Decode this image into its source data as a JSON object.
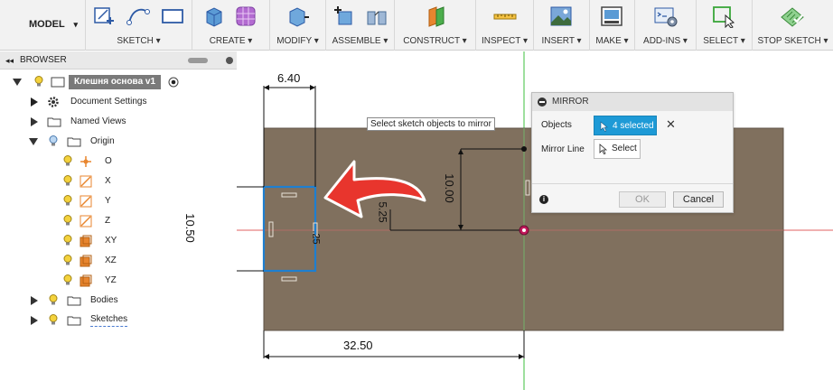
{
  "toolbar": {
    "mode_label": "MODEL",
    "groups": {
      "sketch": "SKETCH ▾",
      "create": "CREATE ▾",
      "modify": "MODIFY ▾",
      "assemble": "ASSEMBLE ▾",
      "construct": "CONSTRUCT ▾",
      "inspect": "INSPECT ▾",
      "insert": "INSERT ▾",
      "make": "MAKE ▾",
      "addins": "ADD-INS ▾",
      "select": "SELECT ▾",
      "stop_sketch": "STOP SKETCH ▾"
    }
  },
  "browser": {
    "title": "BROWSER",
    "root": "Клешня основа v1",
    "items": [
      {
        "label": "Document Settings"
      },
      {
        "label": "Named Views"
      },
      {
        "label": "Origin"
      },
      {
        "label": "O"
      },
      {
        "label": "X"
      },
      {
        "label": "Y"
      },
      {
        "label": "Z"
      },
      {
        "label": "XY"
      },
      {
        "label": "XZ"
      },
      {
        "label": "YZ"
      },
      {
        "label": "Bodies"
      },
      {
        "label": "Sketches"
      }
    ]
  },
  "canvas": {
    "tooltip": "Select sketch objects to mirror",
    "dimensions": {
      "width_top": "6.40",
      "height_left": "10.50",
      "height_mid": "10.00",
      "small_a": "5.25",
      "small_b": ".25",
      "width_bottom": "32.50"
    }
  },
  "mirror_dialog": {
    "title": "MIRROR",
    "objects_label": "Objects",
    "objects_value": "4 selected",
    "mirror_line_label": "Mirror Line",
    "mirror_line_value": "Select",
    "ok_label": "OK",
    "cancel_label": "Cancel"
  },
  "colors": {
    "body": "#80705e",
    "body_border": "#5e5246",
    "selection": "#1e7fd0",
    "arrow": "#e8352d",
    "axis_green": "#3cbf3c",
    "axis_red": "#e06060",
    "dialog_accent": "#1e9ad6"
  }
}
